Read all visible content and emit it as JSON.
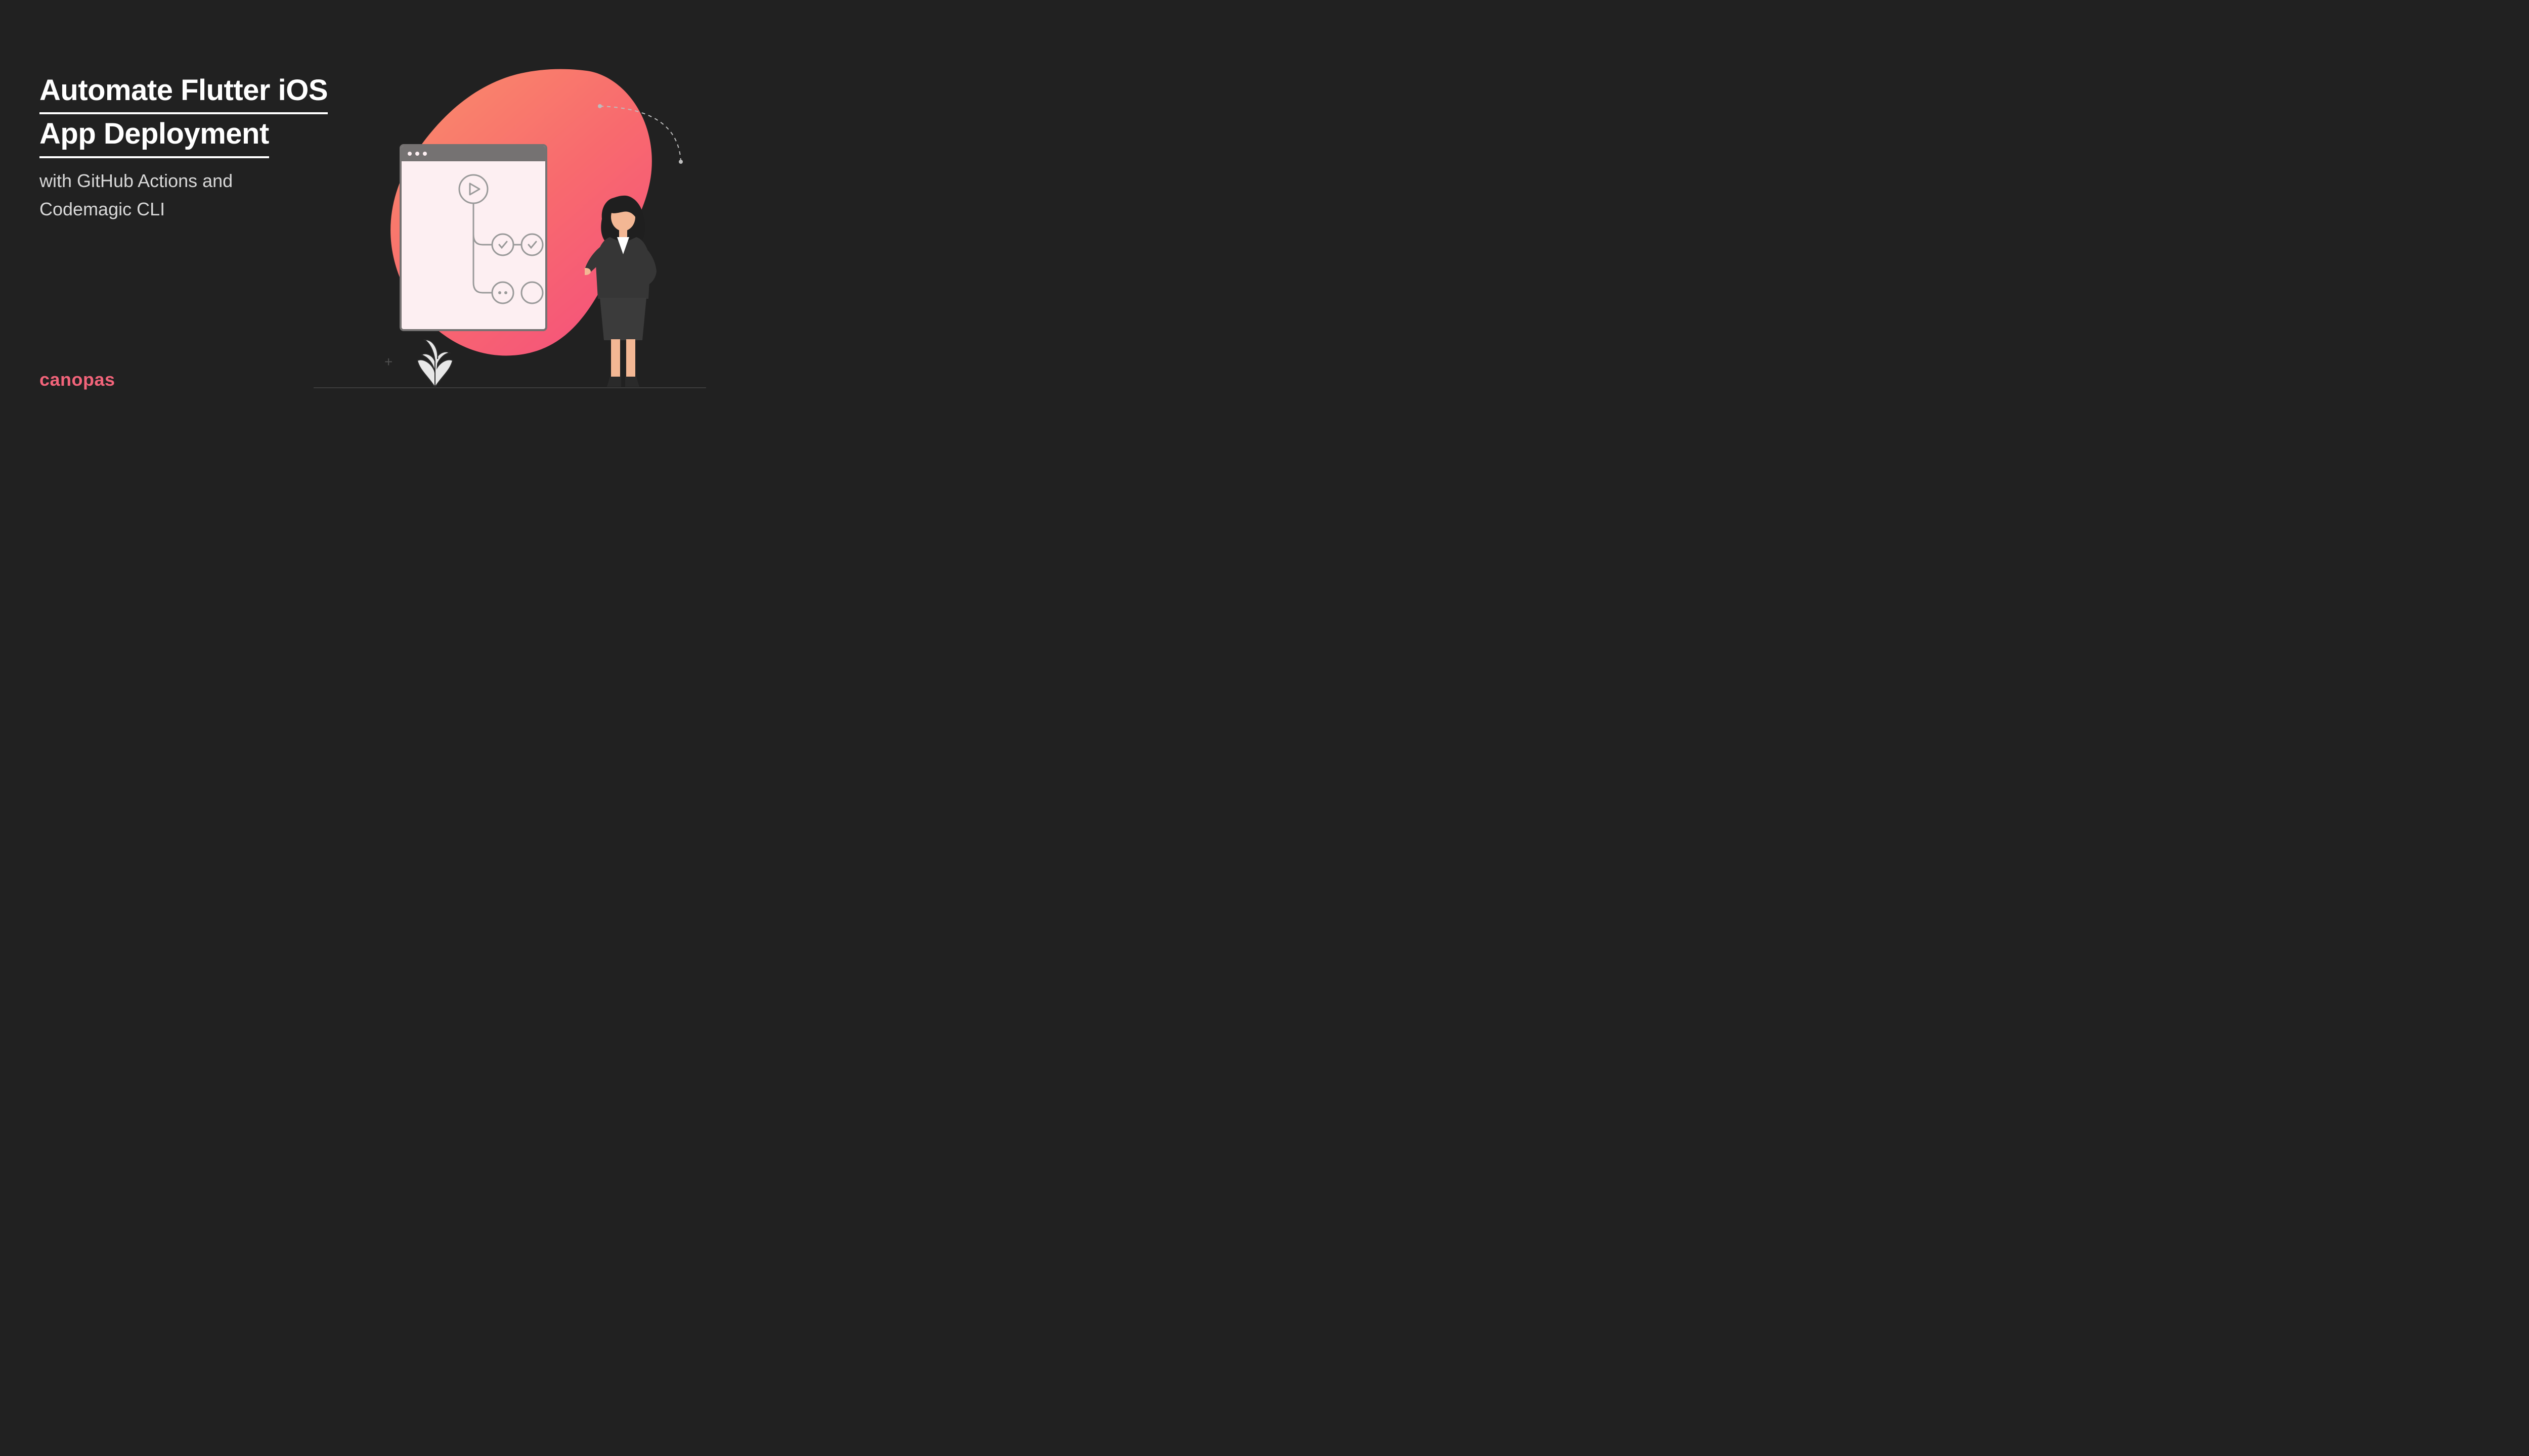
{
  "title_line1": "Automate Flutter iOS",
  "title_line2": "App Deployment",
  "subtitle_line1": "with GitHub Actions and",
  "subtitle_line2": "Codemagic CLI",
  "brand": "canopas",
  "colors": {
    "bg": "#212121",
    "text": "#ffffff",
    "subtext": "#d8d8d8",
    "brand": "#f2647a",
    "blob_start": "#fa8365",
    "blob_end": "#f5527b",
    "window_border": "#757272",
    "window_bg": "#fdeff2",
    "node_stroke": "#9a9a9a"
  },
  "icons": {
    "play": "play-icon",
    "check": "check-icon",
    "dots": "dots-icon",
    "empty": "empty-icon"
  }
}
